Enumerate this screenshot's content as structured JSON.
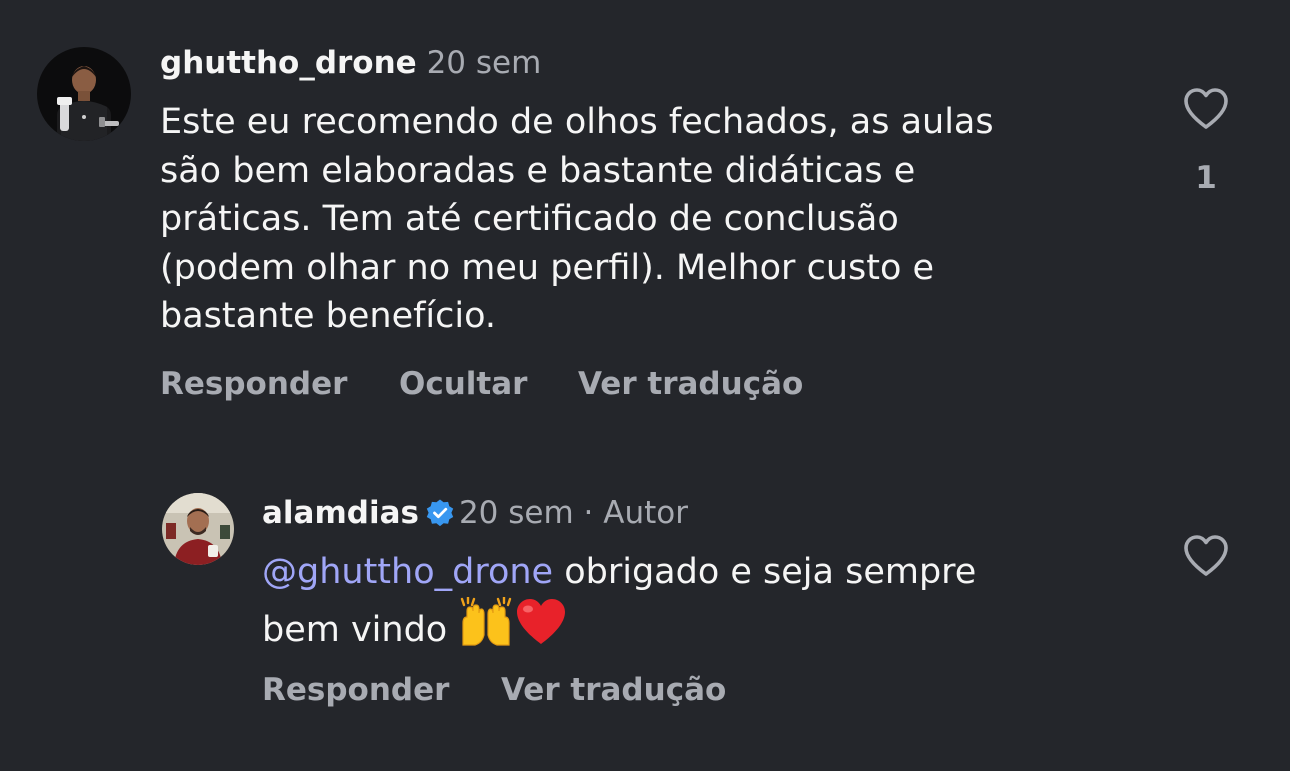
{
  "comments": [
    {
      "username": "ghuttho_drone",
      "time": "20 sem",
      "text_lines": [
        "Este eu recomendo de olhos fechados, as aulas",
        "são bem elaboradas e bastante didáticas e",
        "práticas. Tem até certificado de conclusão",
        "(podem olhar no meu perfil). Melhor custo e",
        "bastante benefício."
      ],
      "actions": [
        "Responder",
        "Ocultar",
        "Ver tradução"
      ],
      "like_count": "1",
      "icons": {
        "like": "heart-outline-icon"
      }
    },
    {
      "username": "alamdias",
      "verified": true,
      "time": "20 sem",
      "separator": "·",
      "author_label": "Autor",
      "mention": "@ghuttho_drone",
      "text_line_1_rest": " obrigado e seja sempre",
      "text_line_2": "bem vindo",
      "emojis": [
        "raising-hands-emoji",
        "red-heart-emoji"
      ],
      "actions": [
        "Responder",
        "Ver tradução"
      ],
      "icons": {
        "like": "heart-outline-icon",
        "verified": "verified-badge-icon"
      }
    }
  ],
  "colors": {
    "background": "#24262b",
    "text_primary": "#f5f5f5",
    "text_secondary": "#a8abb2",
    "mention": "#a0a6f7",
    "verified_badge": "#3897f0"
  }
}
